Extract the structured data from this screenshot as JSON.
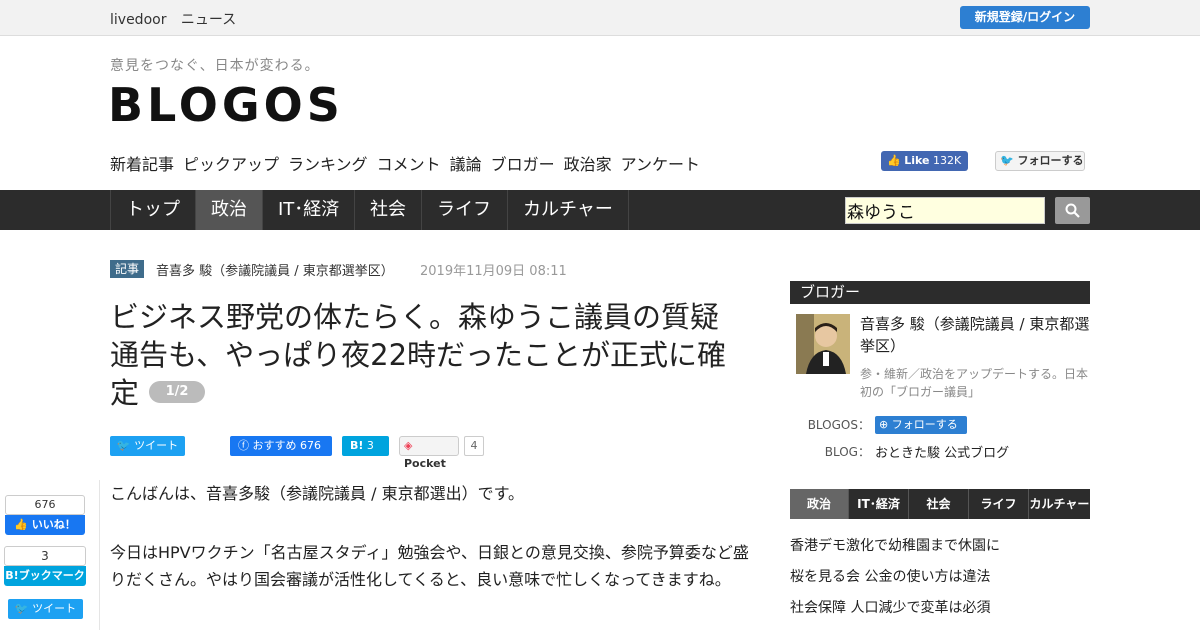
{
  "topbar": {
    "brand": "livedoor",
    "section": "ニュース",
    "login": "新規登録/ログイン"
  },
  "header": {
    "tagline": "意見をつなぐ、日本が変わる。",
    "logo": "BLOGOS"
  },
  "subnav": [
    "新着記事",
    "ピックアップ",
    "ランキング",
    "コメント",
    "議論",
    "ブロガー",
    "政治家",
    "アンケート"
  ],
  "social": {
    "fb_like": "Like",
    "fb_count": "132K",
    "tw_follow": "フォローする"
  },
  "mainnav": {
    "items": [
      "トップ",
      "政治",
      "IT･経済",
      "社会",
      "ライフ",
      "カルチャー"
    ],
    "active": "政治"
  },
  "search": {
    "value": "森ゆうこ"
  },
  "article": {
    "tag": "記事",
    "author": "音喜多 駿（参議院議員 / 東京都選挙区）",
    "date": "2019年11月09日 08:11",
    "title": "ビジネス野党の体たらく。森ゆうこ議員の質疑通告も、やっぱり夜22時だったことが正式に確定",
    "page": "1/2",
    "share_tw": "ツイート",
    "share_fb": "おすすめ 676",
    "share_hb_count": "3",
    "share_pocket": "Pocket",
    "pocket_count": "4",
    "paragraphs": [
      "こんばんは、音喜多駿（参議院議員 / 東京都選出）です。",
      "今日はHPVワクチン「名古屋スタディ」勉強会や、日銀との意見交換、参院予算委など盛りだくさん。やはり国会審議が活性化してくると、良い意味で忙しくなってきますね。"
    ]
  },
  "side_share": {
    "like_count": "676",
    "like": "いいね！",
    "hb_count": "3",
    "hb": "B!ブックマーク",
    "tw": "ツイート"
  },
  "sidebar": {
    "heading": "ブロガー",
    "blogger_name": "音喜多 駿（参議院議員 / 東京都選挙区）",
    "blogger_desc": "参・維新／政治をアップデートする。日本初の「ブロガー議員」",
    "blogos_label": "BLOGOS：",
    "follow": "フォローする",
    "blog_label": "BLOG：",
    "blog_link": "おときた駿 公式ブログ",
    "tabs": [
      "政治",
      "IT･経済",
      "社会",
      "ライフ",
      "カルチャー"
    ],
    "news": [
      "香港デモ激化で幼稚園まで休園に",
      "桜を見る会 公金の使い方は違法",
      "社会保障 人口減少で変革は必須"
    ]
  },
  "colors": {
    "nav_bg": "#2c2c2c",
    "accent_blue": "#2d7fd2",
    "tag_blue": "#3f6c8b"
  }
}
